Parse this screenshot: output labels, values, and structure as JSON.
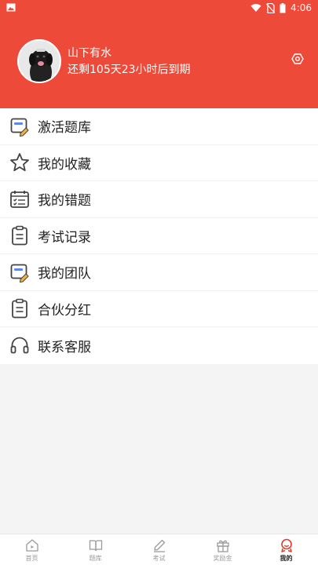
{
  "status_bar": {
    "time": "4:06"
  },
  "profile": {
    "name": "山下有水",
    "expire_text": "还剩105天23小时后到期"
  },
  "menu": {
    "items": [
      {
        "label": "激活题库",
        "icon": "card-pen-icon"
      },
      {
        "label": "我的收藏",
        "icon": "star-icon"
      },
      {
        "label": "我的错题",
        "icon": "calendar-check-icon"
      },
      {
        "label": "考试记录",
        "icon": "clipboard-icon"
      },
      {
        "label": "我的团队",
        "icon": "card-pen-icon"
      },
      {
        "label": "合伙分红",
        "icon": "clipboard-icon"
      },
      {
        "label": "联系客服",
        "icon": "headset-icon"
      }
    ]
  },
  "tabbar": {
    "active": "我的",
    "tabs": [
      {
        "label": "首页",
        "icon": "home-play-icon"
      },
      {
        "label": "题库",
        "icon": "book-icon"
      },
      {
        "label": "考试",
        "icon": "pencil-icon"
      },
      {
        "label": "奖励金",
        "icon": "gift-icon"
      },
      {
        "label": "我的",
        "icon": "user-icon"
      }
    ]
  },
  "colors": {
    "primary": "#ee4a3a",
    "active_tab": "#e8392a",
    "background": "#f4f4f4"
  }
}
